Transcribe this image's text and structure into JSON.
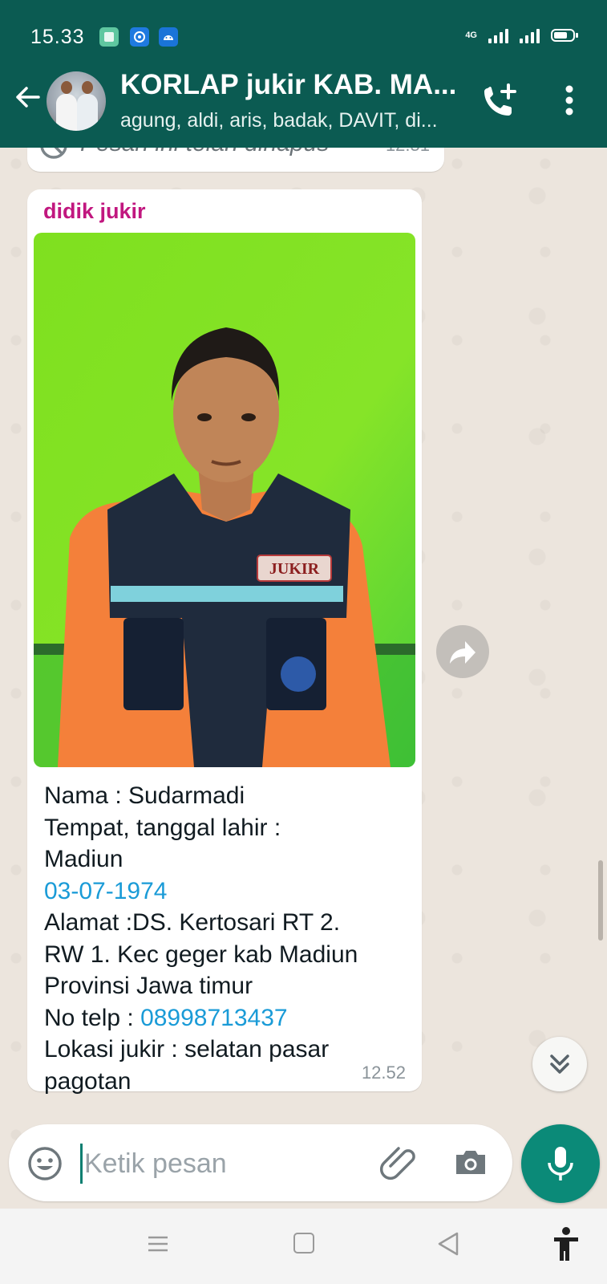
{
  "status_bar": {
    "time": "15.33",
    "network": "4G",
    "battery_level": 0.6
  },
  "header": {
    "title": "KORLAP jukir KAB. MA...",
    "subtitle": "agung, aldi, aris, badak, DAVIT, di...",
    "accent_color": "#0b5b52"
  },
  "messages": {
    "deleted": {
      "text": "Pesan ini telah dihapus",
      "time": "12.51"
    },
    "main": {
      "sender": "didik jukir",
      "sender_color": "#c1177f",
      "caption": {
        "line1": "Nama : Sudarmadi",
        "line2": "Tempat, tanggal lahir :",
        "line3": "Madiun",
        "date_link": "03-07-1974",
        "address": "Alamat :DS. Kertosari RT 2.\nRW 1. Kec geger kab Madiun\nProvinsi Jawa timur",
        "phone_prefix": "No telp : ",
        "phone_link": "08998713437",
        "location": "Lokasi jukir : selatan pasar\npagotan"
      },
      "photo_badge": "JUKIR",
      "time": "12.52"
    }
  },
  "composer": {
    "placeholder": "Ketik pesan"
  },
  "icons": {
    "back": "arrow-left-icon",
    "add_call": "add-call-icon",
    "menu": "more-vert-icon",
    "forward": "forward-icon",
    "scroll_down": "chevron-double-down-icon",
    "emoji": "emoji-icon",
    "attach": "paperclip-icon",
    "camera": "camera-icon",
    "mic": "mic-icon"
  }
}
